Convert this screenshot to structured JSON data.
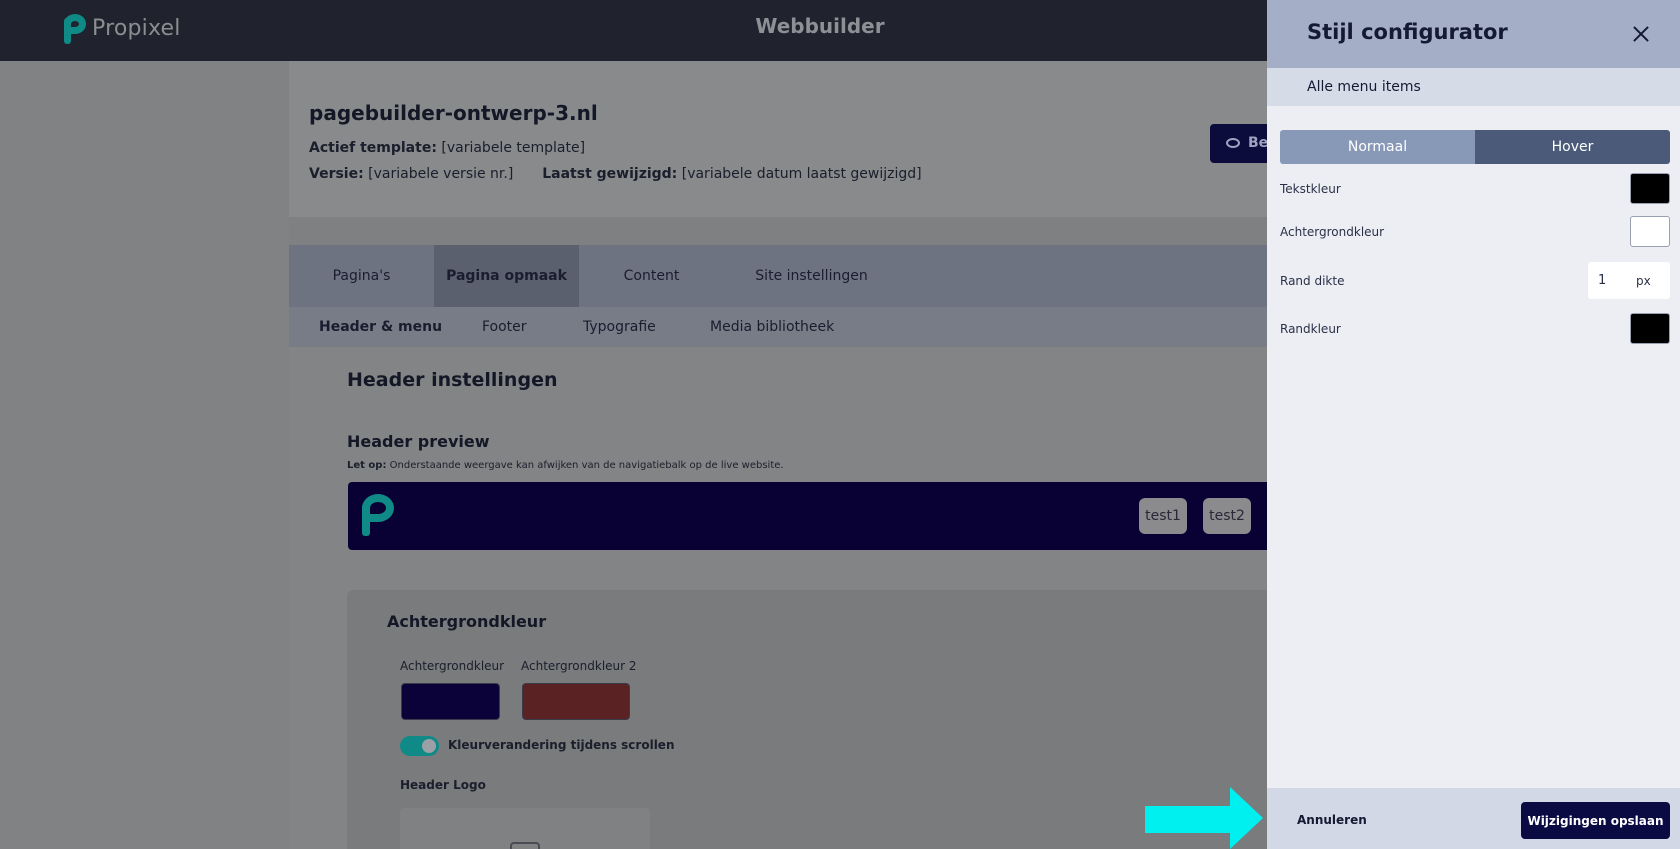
{
  "topbar": {
    "logo_text": "Propixel",
    "app_title": "Webbuilder"
  },
  "site": {
    "name": "pagebuilder-ontwerp-3.nl",
    "template_label": "Actief template:",
    "template_value": "[variabele template]",
    "version_label": "Versie:",
    "version_value": "[variabele versie nr.]",
    "modified_label": "Laatst gewijzigd:",
    "modified_value": "[variabele datum laatst gewijzigd]",
    "preview_button": "Be"
  },
  "tabs": [
    {
      "label": "Pagina's"
    },
    {
      "label": "Pagina opmaak"
    },
    {
      "label": "Content"
    },
    {
      "label": "Site instellingen"
    }
  ],
  "subtabs": [
    {
      "label": "Header & menu"
    },
    {
      "label": "Footer"
    },
    {
      "label": "Typografie"
    },
    {
      "label": "Media bibliotheek"
    }
  ],
  "header_settings": {
    "title": "Header instellingen",
    "preview_title": "Header preview",
    "note_bold": "Let op:",
    "note_text": " Onderstaande weergave kan afwijken van de navigatiebalk op de live website.",
    "menu_items": [
      "test1",
      "test2"
    ],
    "bg_section_title": "Achtergrondkleur",
    "bg_color_label": "Achtergrondkleur",
    "bg_color2_label": "Achtergrondkleur 2",
    "bg_color": "#0a0238",
    "bg_color2": "#5a2222",
    "scroll_toggle_label": "Kleurverandering tijdens scrollen",
    "scroll_toggle_on": true,
    "logo_label": "Header Logo"
  },
  "drawer": {
    "title": "Stijl configurator",
    "section": "Alle menu items",
    "modes": [
      "Normaal",
      "Hover"
    ],
    "active_mode": "Hover",
    "props": {
      "text_color_label": "Tekstkleur",
      "text_color": "#000000",
      "bg_color_label": "Achtergrondkleur",
      "bg_color": "#ffffff",
      "border_width_label": "Rand dikte",
      "border_width_value": "1",
      "border_width_unit": "px",
      "border_color_label": "Randkleur",
      "border_color": "#000000"
    },
    "cancel_label": "Annuleren",
    "save_label": "Wijzigingen opslaan"
  },
  "colors": {
    "accent": "#0f8a86",
    "navy": "#0b0b44",
    "annotation_arrow": "#00f0f0"
  }
}
